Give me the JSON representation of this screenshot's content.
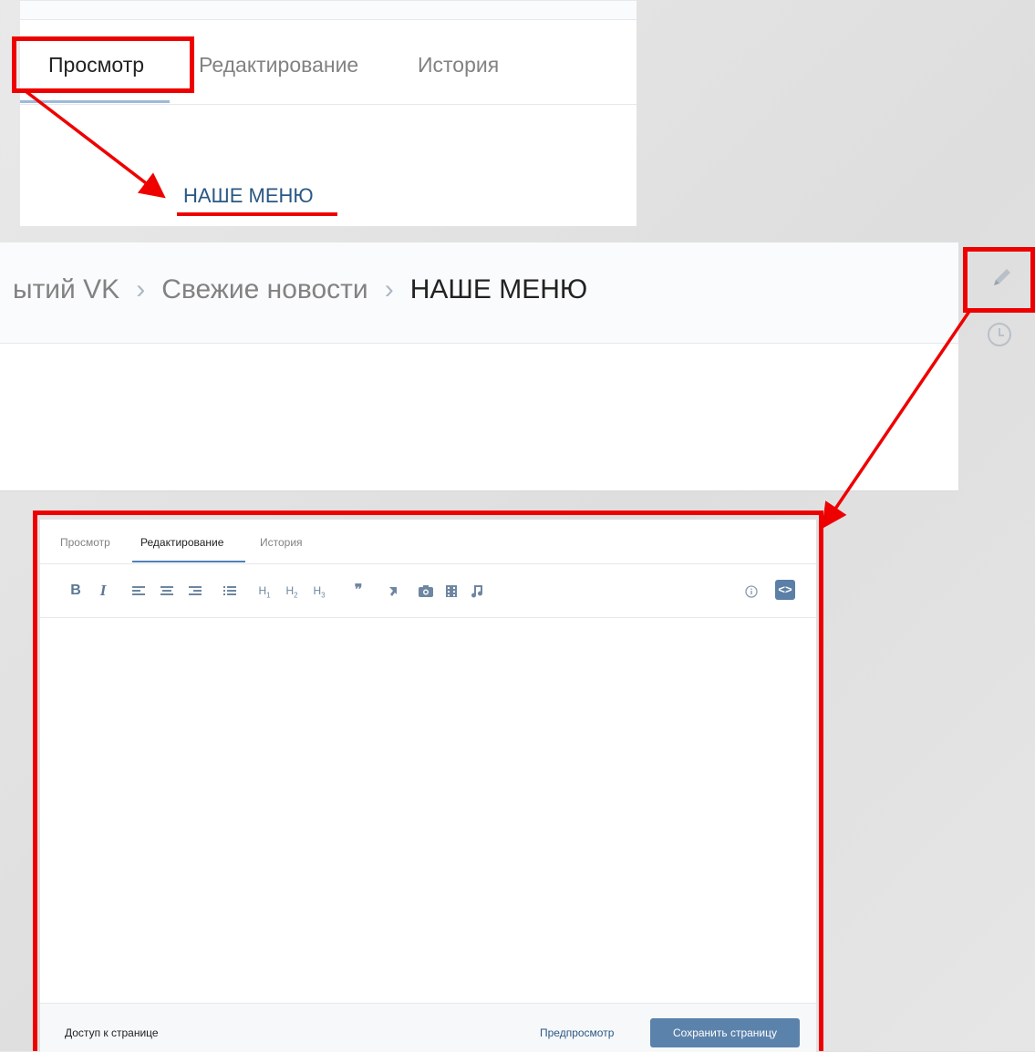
{
  "top_panel": {
    "tabs": [
      "Просмотр",
      "Редактирование",
      "История"
    ],
    "active_tab": "Просмотр",
    "menu_link": "НАШЕ МЕНЮ"
  },
  "breadcrumb_panel": {
    "crumbs": [
      "ытий VK",
      "Свежие новости",
      "НАШЕ МЕНЮ"
    ],
    "separator": "›",
    "icons": [
      "pencil-icon",
      "history-clock-icon"
    ]
  },
  "editor": {
    "tabs": [
      "Просмотр",
      "Редактирование",
      "История"
    ],
    "active_tab": "Редактирование",
    "toolbar": {
      "bold": "B",
      "italic": "I",
      "h1": "H",
      "h2": "H",
      "h3": "H",
      "h1_sub": "1",
      "h2_sub": "2",
      "h3_sub": "3",
      "quote": "❞",
      "code": "<>"
    },
    "footer": {
      "access": "Доступ к странице",
      "preview": "Предпросмотр",
      "save": "Сохранить страницу"
    }
  },
  "colors": {
    "annotation_red": "#ee0000",
    "vk_blue": "#5181b8",
    "link": "#2a5885"
  }
}
